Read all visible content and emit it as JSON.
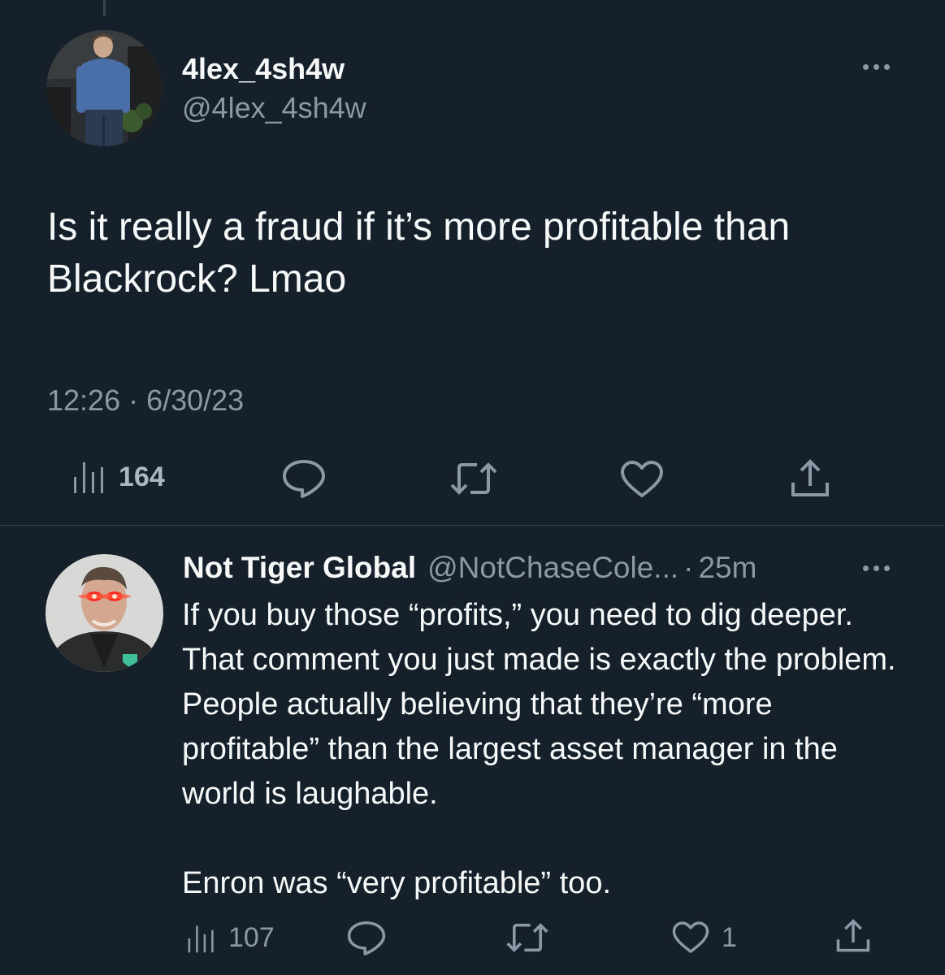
{
  "tweet": {
    "author_name": "4lex_4sh4w",
    "author_handle": "@4lex_4sh4w",
    "text": "Is it really a fraud if it’s more profitable than Blackrock? Lmao",
    "timestamp": "12:26 · 6/30/23",
    "views": "164"
  },
  "reply": {
    "author_name": "Not Tiger Global",
    "author_handle": "@NotChaseCole...",
    "separator": "·",
    "time": "25m",
    "paragraph_1": "If you buy those “profits,” you need to dig deeper. That comment you just made is exactly the problem. People actually believing that they’re “more profitable” than the largest asset manager in the world is laughable.",
    "paragraph_2": "Enron was “very profitable” too.",
    "views": "107",
    "likes": "1"
  },
  "icons": {
    "views": "bar-chart-icon",
    "reply": "speech-bubble-icon",
    "retweet": "retweet-icon",
    "like": "heart-icon",
    "share": "share-icon",
    "more": "more-dots-icon"
  },
  "colors": {
    "background": "#15202b",
    "text_primary": "#f7f9f9",
    "text_secondary": "#8b98a5",
    "divider": "#38444d"
  }
}
